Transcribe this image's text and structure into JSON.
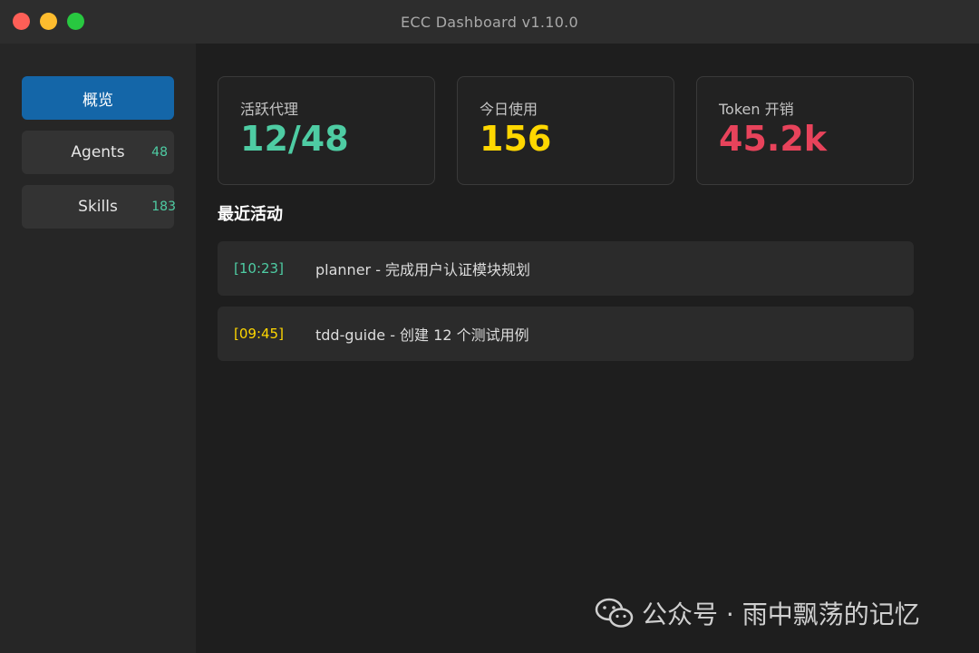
{
  "window": {
    "title": "ECC Dashboard v1.10.0"
  },
  "sidebar": {
    "items": [
      {
        "label": "概览",
        "count": ""
      },
      {
        "label": "Agents",
        "count": "48"
      },
      {
        "label": "Skills",
        "count": "183"
      }
    ]
  },
  "stats": [
    {
      "label": "活跃代理",
      "value": "12/48",
      "color": "#4ecca3"
    },
    {
      "label": "今日使用",
      "value": "156",
      "color": "#ffd700"
    },
    {
      "label": "Token 开销",
      "value": "45.2k",
      "color": "#e8435b"
    }
  ],
  "activity": {
    "title": "最近活动",
    "items": [
      {
        "time": "[10:23]",
        "text": "planner - 完成用户认证模块规划",
        "time_color": "#4ecca3"
      },
      {
        "time": "[09:45]",
        "text": "tdd-guide - 创建 12 个测试用例",
        "time_color": "#ffd700"
      }
    ]
  },
  "watermark": {
    "text": "公众号 · 雨中飘荡的记忆",
    "icon": "wechat-icon"
  },
  "colors": {
    "accent": "#1466a8",
    "sidebar_bg": "#262626",
    "content_bg": "#1e1e1e"
  }
}
